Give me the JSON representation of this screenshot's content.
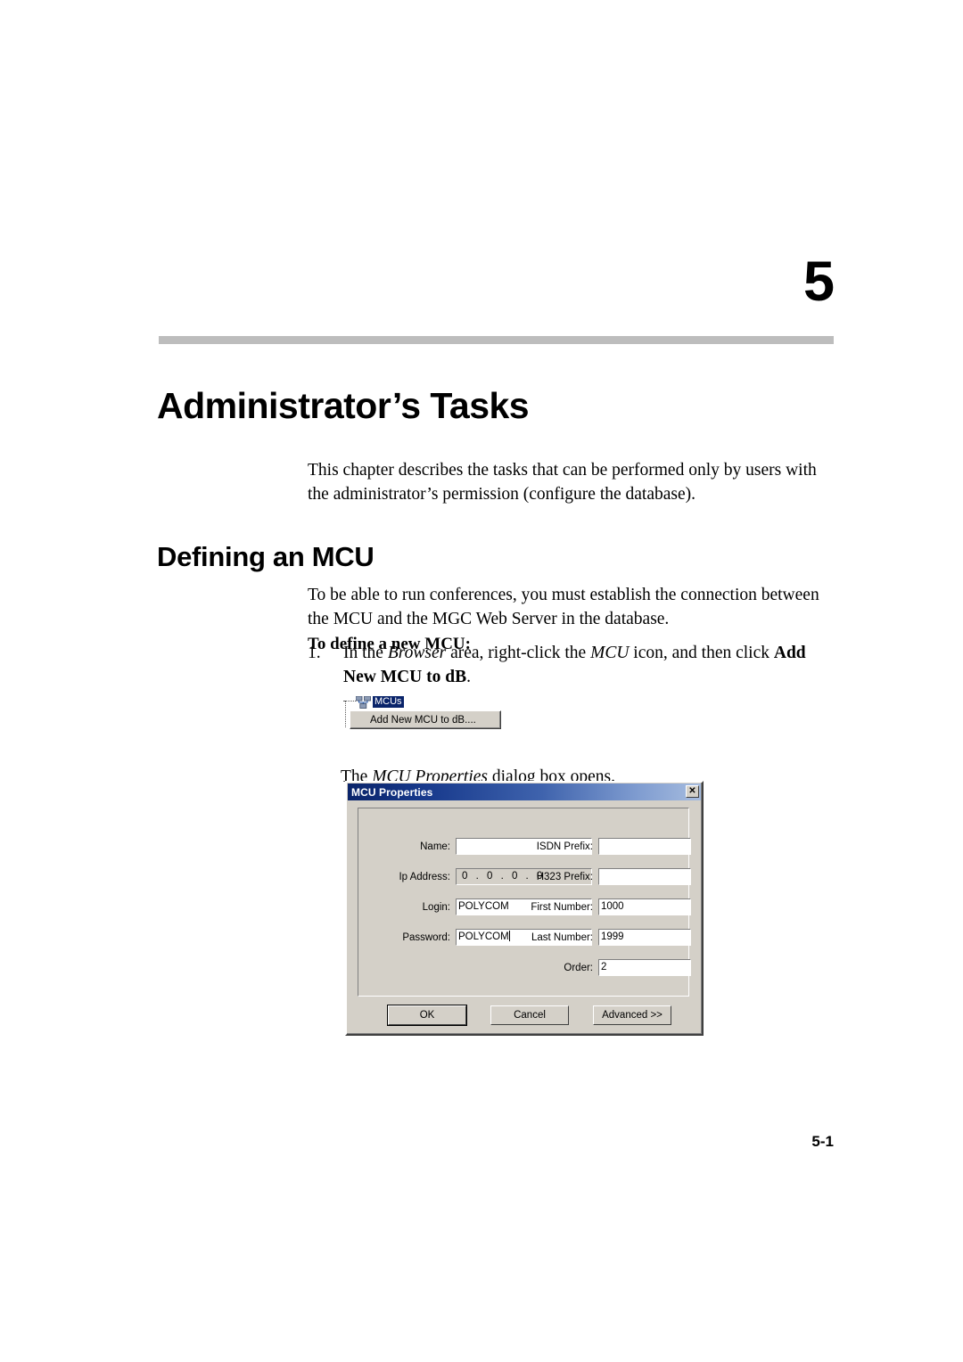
{
  "chapter": {
    "number": "5",
    "title": "Administrator’s Tasks"
  },
  "intro": "This chapter describes the tasks that can be performed only by users with the administrator’s permission (configure the database).",
  "section": {
    "heading": "Defining an MCU",
    "paragraph": "To be able to run conferences, you must establish the connection between the MCU and the MGC Web Server in the database.",
    "sub_heading": "To define a new MCU:",
    "step": {
      "number": "1.",
      "text_part1": "In the ",
      "italic1": "Browser",
      "text_part2": " area, right-click the ",
      "italic2": "MCU",
      "text_part3": " icon, and then click ",
      "bold1": "Add New MCU to dB",
      "text_part4": "."
    },
    "after_figure": {
      "text_part1": "The ",
      "italic1": "MCU Properties",
      "text_part2": " dialog box opens."
    }
  },
  "tree_figure": {
    "node_label": "MCUs",
    "menu_item": "Add New MCU to dB...."
  },
  "dialog": {
    "title": "MCU Properties",
    "close_label": "✕",
    "fields_left": [
      {
        "label": "Name:",
        "value": "",
        "masked": false
      },
      {
        "label": "Ip Address:",
        "value": "0 . 0 . 0 . 0",
        "masked": true
      },
      {
        "label": "Login:",
        "value": "POLYCOM",
        "masked": false
      },
      {
        "label": "Password:",
        "value": "POLYCOM",
        "masked": false
      }
    ],
    "fields_right": [
      {
        "label": "ISDN Prefix:",
        "value": ""
      },
      {
        "label": "H323 Prefix:",
        "value": ""
      },
      {
        "label": "First Number:",
        "value": "1000"
      },
      {
        "label": "Last Number:",
        "value": "1999"
      },
      {
        "label": "Order:",
        "value": "2"
      }
    ],
    "buttons": {
      "ok": "OK",
      "cancel": "Cancel",
      "advanced": "Advanced >>"
    }
  },
  "footer": {
    "page_number": "5-1"
  }
}
